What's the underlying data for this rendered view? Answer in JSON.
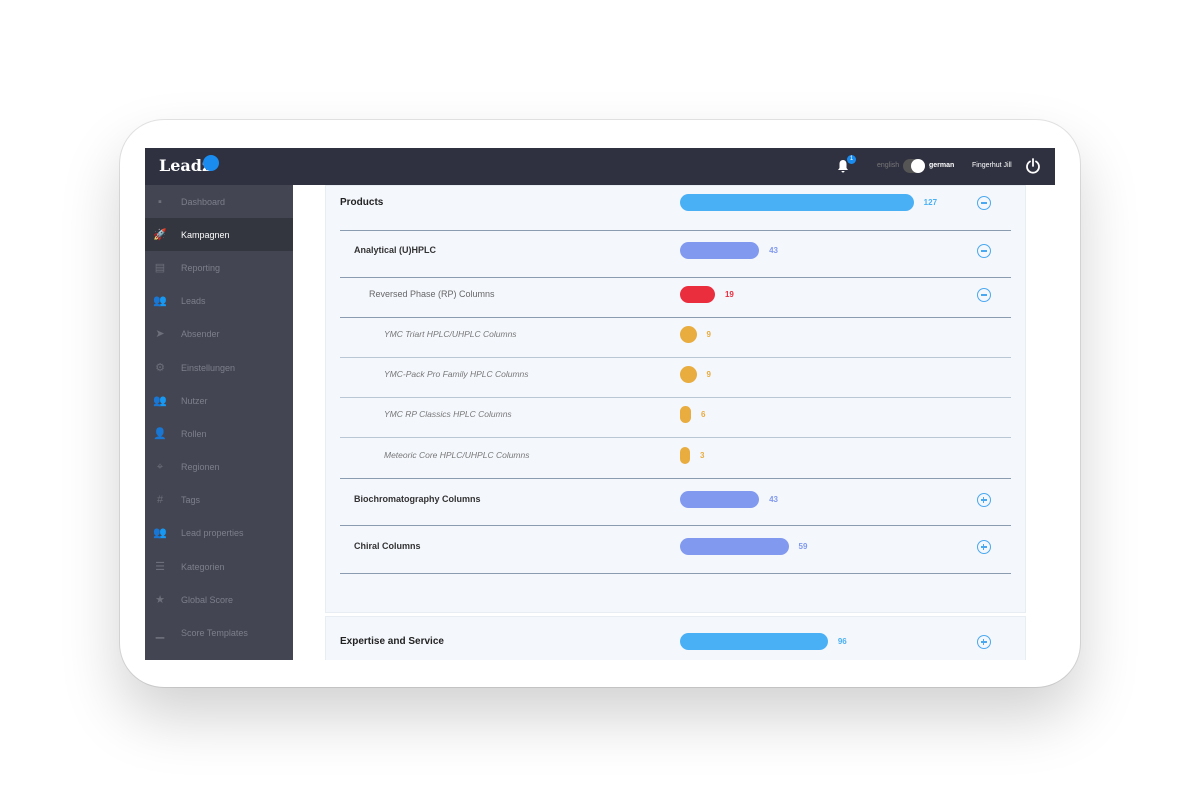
{
  "header": {
    "logo": "Leadz",
    "notifications": "1",
    "lang_english": "english",
    "lang_german": "german",
    "user": "Fingerhut Jill"
  },
  "sidebar": {
    "active": "Kampagnen",
    "items": [
      {
        "label": "Dashboard",
        "icon": "grid-icon"
      },
      {
        "label": "Kampagnen",
        "icon": "rocket-icon"
      },
      {
        "label": "Reporting",
        "icon": "report-icon"
      },
      {
        "label": "Leads",
        "icon": "people-icon"
      },
      {
        "label": "Absender",
        "icon": "paper-plane-icon"
      },
      {
        "label": "Einstellungen",
        "icon": "gear-icon"
      },
      {
        "label": "Nutzer",
        "icon": "people-icon"
      },
      {
        "label": "Rollen",
        "icon": "user-gear-icon"
      },
      {
        "label": "Regionen",
        "icon": "map-icon"
      },
      {
        "label": "Tags",
        "icon": "hash-icon"
      },
      {
        "label": "Lead properties",
        "icon": "people-icon"
      },
      {
        "label": "Kategorien",
        "icon": "list-icon"
      },
      {
        "label": "Global Score",
        "icon": "star-icon"
      },
      {
        "label": "Score Templates",
        "icon": "signal-icon"
      }
    ]
  },
  "colors": {
    "level0": "#4ab0f5",
    "level1": "#8199ee",
    "level2": "#ea2e3e",
    "level3": "#e8ac3f"
  },
  "tree": [
    {
      "label": "Products",
      "value": 127,
      "level": 0,
      "toggle": "collapse"
    },
    {
      "label": "Analytical (U)HPLC",
      "value": 43,
      "level": 1,
      "toggle": "collapse"
    },
    {
      "label": "Reversed Phase (RP) Columns",
      "value": 19,
      "level": 2,
      "toggle": "collapse"
    },
    {
      "label": "YMC Triart HPLC/UHPLC Columns",
      "value": 9,
      "level": 3
    },
    {
      "label": "YMC-Pack Pro Family HPLC Columns",
      "value": 9,
      "level": 3
    },
    {
      "label": "YMC RP Classics HPLC Columns",
      "value": 6,
      "level": 3
    },
    {
      "label": "Meteoric Core HPLC/UHPLC Columns",
      "value": 3,
      "level": 3
    },
    {
      "label": "Biochromatography Columns",
      "value": 43,
      "level": 1,
      "toggle": "expand"
    },
    {
      "label": "Chiral Columns",
      "value": 59,
      "level": 1,
      "toggle": "expand"
    }
  ],
  "second_panel": {
    "label": "Expertise and Service",
    "value": 96,
    "toggle": "expand"
  }
}
